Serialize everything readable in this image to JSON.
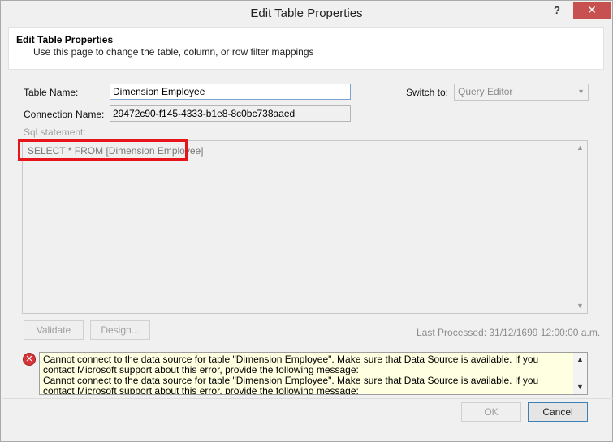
{
  "window": {
    "title": "Edit Table Properties",
    "help_glyph": "?",
    "close_glyph": "✕"
  },
  "header": {
    "title": "Edit Table Properties",
    "subtitle": "Use this page to change the table, column, or row filter mappings"
  },
  "form": {
    "table_name_label": "Table Name:",
    "table_name_value": "Dimension Employee",
    "connection_name_label": "Connection Name:",
    "connection_name_value": "29472c90-f145-4333-b1e8-8c0bc738aaed",
    "switch_to_label": "Switch to:",
    "switch_to_value": "Query Editor",
    "sql_statement_label": "Sql statement:",
    "sql_statement_value": "SELECT * FROM [Dimension Employee]"
  },
  "actions": {
    "validate_label": "Validate",
    "design_label": "Design...",
    "last_processed": "Last Processed: 31/12/1699 12:00:00 a.m."
  },
  "message": {
    "lines": [
      "Cannot connect to  the data source for table \"Dimension Employee\". Make sure that Data Source is available. If you contact Microsoft support about this error, provide the following message:",
      "Cannot connect to  the data source for table \"Dimension Employee\". Make sure that Data Source is available. If you contact Microsoft support about this error, provide the following message:"
    ]
  },
  "footer": {
    "ok_label": "OK",
    "cancel_label": "Cancel"
  },
  "colors": {
    "highlight": "#e8141b",
    "close_button": "#c75050",
    "message_background": "#ffffe1",
    "error_icon": "#d6353a"
  }
}
